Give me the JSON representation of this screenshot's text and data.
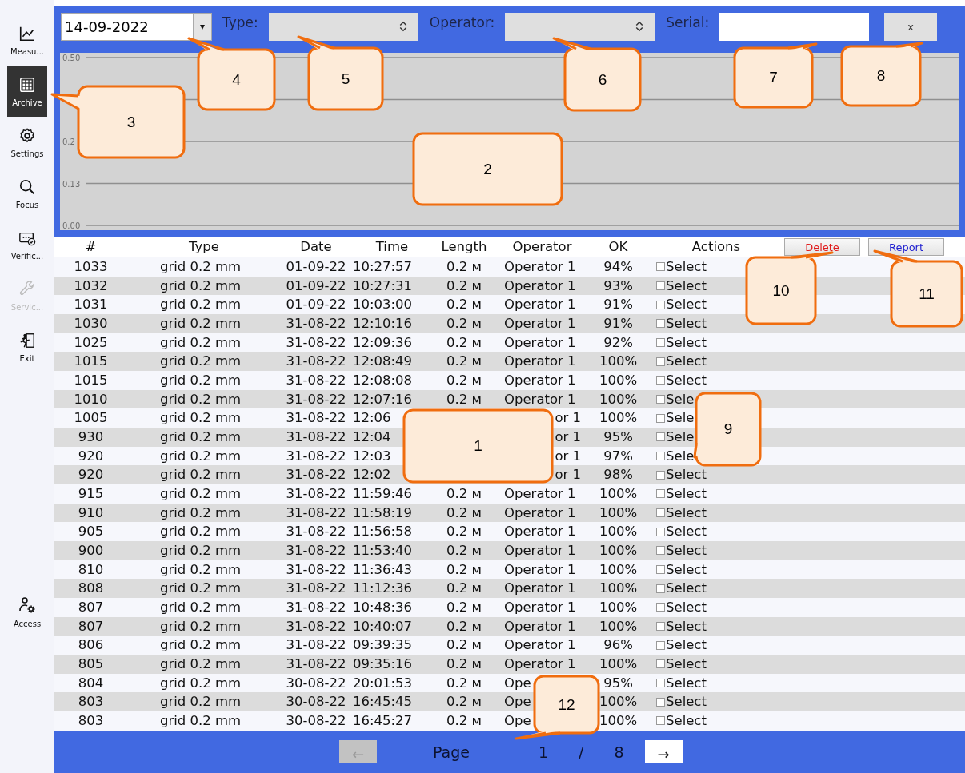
{
  "sidebar": {
    "items": [
      {
        "label": "Measu...",
        "kind": "chart",
        "selected": false,
        "disabled": false
      },
      {
        "label": "Archive",
        "kind": "grid",
        "selected": true,
        "disabled": false
      },
      {
        "label": "Settings",
        "kind": "gear",
        "selected": false,
        "disabled": false
      },
      {
        "label": "Focus",
        "kind": "magnifier",
        "selected": false,
        "disabled": false
      },
      {
        "label": "Verific...",
        "kind": "ticket",
        "selected": false,
        "disabled": false
      },
      {
        "label": "Servic...",
        "kind": "wrench",
        "selected": false,
        "disabled": true
      },
      {
        "label": "Exit",
        "kind": "exit",
        "selected": false,
        "disabled": false
      }
    ],
    "bottom_item": {
      "label": "Access",
      "kind": "access"
    }
  },
  "filters": {
    "date": {
      "value": "14-09-2022",
      "dropdown": "▾"
    },
    "type": {
      "label": "Type:"
    },
    "operator": {
      "label": "Operator:"
    },
    "serial": {
      "label": "Serial:"
    },
    "clear_button": {
      "label": "x"
    }
  },
  "chart": {
    "tick_labels": [
      "0.50",
      "0.2",
      "0.13",
      "0.00"
    ]
  },
  "table": {
    "columns": [
      "#",
      "Type",
      "Date",
      "Time",
      "Length",
      "Operator",
      "OK",
      "Actions"
    ],
    "delete_button": "Delete",
    "report_button": "Report",
    "rows": [
      {
        "num": "1033",
        "type": "grid 0.2 mm",
        "date": "01-09-22",
        "time": "10:27:57",
        "length": "0.2 м",
        "operator": "Operator 1",
        "ok": "94%",
        "select": "Select",
        "checked": false
      },
      {
        "num": "1032",
        "type": "grid 0.2 mm",
        "date": "01-09-22",
        "time": "10:27:31",
        "length": "0.2 м",
        "operator": "Operator 1",
        "ok": "93%",
        "select": "Select",
        "checked": false
      },
      {
        "num": "1031",
        "type": "grid 0.2 mm",
        "date": "01-09-22",
        "time": "10:03:00",
        "length": "0.2 м",
        "operator": "Operator 1",
        "ok": "91%",
        "select": "Select",
        "checked": false
      },
      {
        "num": "1030",
        "type": "grid 0.2 mm",
        "date": "31-08-22",
        "time": "12:10:16",
        "length": "0.2 м",
        "operator": "Operator 1",
        "ok": "91%",
        "select": "Select",
        "checked": false
      },
      {
        "num": "1025",
        "type": "grid 0.2 mm",
        "date": "31-08-22",
        "time": "12:09:36",
        "length": "0.2 м",
        "operator": "Operator 1",
        "ok": "92%",
        "select": "Select",
        "checked": false
      },
      {
        "num": "1015",
        "type": "grid 0.2 mm",
        "date": "31-08-22",
        "time": "12:08:49",
        "length": "0.2 м",
        "operator": "Operator 1",
        "ok": "100%",
        "select": "Select",
        "checked": false
      },
      {
        "num": "1015",
        "type": "grid 0.2 mm",
        "date": "31-08-22",
        "time": "12:08:08",
        "length": "0.2 м",
        "operator": "Operator 1",
        "ok": "100%",
        "select": "Select",
        "checked": false
      },
      {
        "num": "1010",
        "type": "grid 0.2 mm",
        "date": "31-08-22",
        "time": "12:07:16",
        "length": "0.2 м",
        "operator": "Operator 1",
        "ok": "100%",
        "select": "Sele",
        "checked": false
      },
      {
        "num": "1005",
        "type": "grid 0.2 mm",
        "date": "31-08-22",
        "time": "12:06",
        "operator": "or 1",
        "operator_clipped_start": true,
        "ok": "100%",
        "select": "Sele",
        "checked": false
      },
      {
        "num": "930",
        "type": "grid 0.2 mm",
        "date": "31-08-22",
        "time": "12:04",
        "operator": "or 1",
        "operator_clipped_start": true,
        "ok": "95%",
        "select": "Sele",
        "checked": false
      },
      {
        "num": "920",
        "type": "grid 0.2 mm",
        "date": "31-08-22",
        "time": "12:03",
        "operator": "or 1",
        "operator_clipped_start": true,
        "ok": "97%",
        "select": "Sele",
        "checked": false
      },
      {
        "num": "920",
        "type": "grid 0.2 mm",
        "date": "31-08-22",
        "time": "12:02",
        "operator": "or 1",
        "operator_clipped_start": true,
        "ok": "98%",
        "select": "Select",
        "checked": false
      },
      {
        "num": "915",
        "type": "grid 0.2 mm",
        "date": "31-08-22",
        "time": "11:59:46",
        "length": "0.2 м",
        "operator": "Operator 1",
        "ok": "100%",
        "select": "Select",
        "checked": false
      },
      {
        "num": "910",
        "type": "grid 0.2 mm",
        "date": "31-08-22",
        "time": "11:58:19",
        "length": "0.2 м",
        "operator": "Operator 1",
        "ok": "100%",
        "select": "Select",
        "checked": false
      },
      {
        "num": "905",
        "type": "grid 0.2 mm",
        "date": "31-08-22",
        "time": "11:56:58",
        "length": "0.2 м",
        "operator": "Operator 1",
        "ok": "100%",
        "select": "Select",
        "checked": false
      },
      {
        "num": "900",
        "type": "grid 0.2 mm",
        "date": "31-08-22",
        "time": "11:53:40",
        "length": "0.2 м",
        "operator": "Operator 1",
        "ok": "100%",
        "select": "Select",
        "checked": false
      },
      {
        "num": "810",
        "type": "grid 0.2 mm",
        "date": "31-08-22",
        "time": "11:36:43",
        "length": "0.2 м",
        "operator": "Operator 1",
        "ok": "100%",
        "select": "Select",
        "checked": false
      },
      {
        "num": "808",
        "type": "grid 0.2 mm",
        "date": "31-08-22",
        "time": "11:12:36",
        "length": "0.2 м",
        "operator": "Operator 1",
        "ok": "100%",
        "select": "Select",
        "checked": false
      },
      {
        "num": "807",
        "type": "grid 0.2 mm",
        "date": "31-08-22",
        "time": "10:48:36",
        "length": "0.2 м",
        "operator": "Operator 1",
        "ok": "100%",
        "select": "Select",
        "checked": false
      },
      {
        "num": "807",
        "type": "grid 0.2 mm",
        "date": "31-08-22",
        "time": "10:40:07",
        "length": "0.2 м",
        "operator": "Operator 1",
        "ok": "100%",
        "select": "Select",
        "checked": false
      },
      {
        "num": "806",
        "type": "grid 0.2 mm",
        "date": "31-08-22",
        "time": "09:39:35",
        "length": "0.2 м",
        "operator": "Operator 1",
        "ok": "96%",
        "select": "Select",
        "checked": false
      },
      {
        "num": "805",
        "type": "grid 0.2 mm",
        "date": "31-08-22",
        "time": "09:35:16",
        "length": "0.2 м",
        "operator": "Operator 1",
        "ok": "100%",
        "select": "Select",
        "checked": false
      },
      {
        "num": "804",
        "type": "grid 0.2 mm",
        "date": "30-08-22",
        "time": "20:01:53",
        "length": "0.2 м",
        "operator": "Ope",
        "ok": "95%",
        "select": "Select",
        "checked": false
      },
      {
        "num": "803",
        "type": "grid 0.2 mm",
        "date": "30-08-22",
        "time": "16:45:45",
        "length": "0.2 м",
        "operator": "Ope",
        "ok": "100%",
        "select": "Select",
        "checked": false
      },
      {
        "num": "803",
        "type": "grid 0.2 mm",
        "date": "30-08-22",
        "time": "16:45:27",
        "length": "0.2 м",
        "operator": "Ope",
        "ok": "100%",
        "select": "Select",
        "checked": false
      }
    ]
  },
  "pagination": {
    "prev": {
      "label": "←",
      "disabled": true
    },
    "page_label": "Page",
    "page": "1",
    "separator": "/",
    "total": "8",
    "next": {
      "label": "→",
      "disabled": false
    }
  },
  "callouts": [
    {
      "label": "1"
    },
    {
      "label": "2"
    },
    {
      "label": "3"
    },
    {
      "label": "4"
    },
    {
      "label": "5"
    },
    {
      "label": "6"
    },
    {
      "label": "7"
    },
    {
      "label": "8"
    },
    {
      "label": "9"
    },
    {
      "label": "10"
    },
    {
      "label": "11"
    },
    {
      "label": "12"
    }
  ]
}
